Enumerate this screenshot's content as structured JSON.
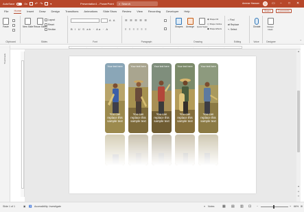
{
  "titlebar": {
    "autosave_label": "AutoSave",
    "autosave_state": "On",
    "doc_title": "Presentation1 - PowerPoint",
    "search_placeholder": "Search",
    "user_name": "Ammar Hassan",
    "minimize": "−",
    "maximize": "□",
    "close": "✕"
  },
  "tabs": {
    "items": [
      "File",
      "Home",
      "Insert",
      "Draw",
      "Design",
      "Transitions",
      "Animations",
      "Slide Show",
      "Review",
      "View",
      "Recording",
      "Developer",
      "Help"
    ],
    "active": "Home",
    "share": "Share",
    "comments": "Comments"
  },
  "ribbon": {
    "clipboard": {
      "paste": "Paste",
      "label": "Clipboard"
    },
    "slides": {
      "new_slide": "New Slide",
      "reuse_slides": "Reuse Slides",
      "layout": "Layout",
      "reset": "Reset",
      "section": "Section",
      "label": "Slides"
    },
    "font": {
      "label": "Font"
    },
    "paragraph": {
      "label": "Paragraph"
    },
    "drawing": {
      "shapes": "Shapes",
      "arrange": "Arrange",
      "quick_styles": "Quick Styles",
      "shape_fill": "Shape Fill",
      "shape_outline": "Shape Outline",
      "shape_effects": "Shape Effects",
      "label": "Drawing"
    },
    "editing": {
      "find": "Find",
      "replace": "Replace",
      "select": "Select",
      "label": "Editing"
    },
    "voice": {
      "dictate": "Dictate",
      "label": "Voice"
    },
    "designer": {
      "design_ideas": "Design Ideas",
      "label": "Designer"
    }
  },
  "left_pane": {
    "label": "Thumbnails"
  },
  "slide": {
    "cards": [
      {
        "top_text": "Your text here",
        "bottom_text": "You can replace this sample text",
        "scene": "harvest-man-blue"
      },
      {
        "top_text": "Your text here",
        "bottom_text": "You can replace this sample text",
        "scene": "harvest-man-hat"
      },
      {
        "top_text": "Your text here",
        "bottom_text": "You can replace this sample text",
        "scene": "harvest-man-red"
      },
      {
        "top_text": "Your text here",
        "bottom_text": "You can replace this sample text",
        "scene": "harvest-man-straw"
      },
      {
        "top_text": "Your text here",
        "bottom_text": "You can replace this sample text",
        "scene": "harvest-man-field"
      }
    ]
  },
  "statusbar": {
    "slide_info": "Slide 1 of 1",
    "accessibility": "Accessibility: Investigate",
    "notes": "Notes",
    "zoom": "66%"
  },
  "colors": {
    "accent": "#b7472a",
    "ribbon_bg": "#f3f3f3",
    "canvas_bg": "#e9e9e9"
  }
}
